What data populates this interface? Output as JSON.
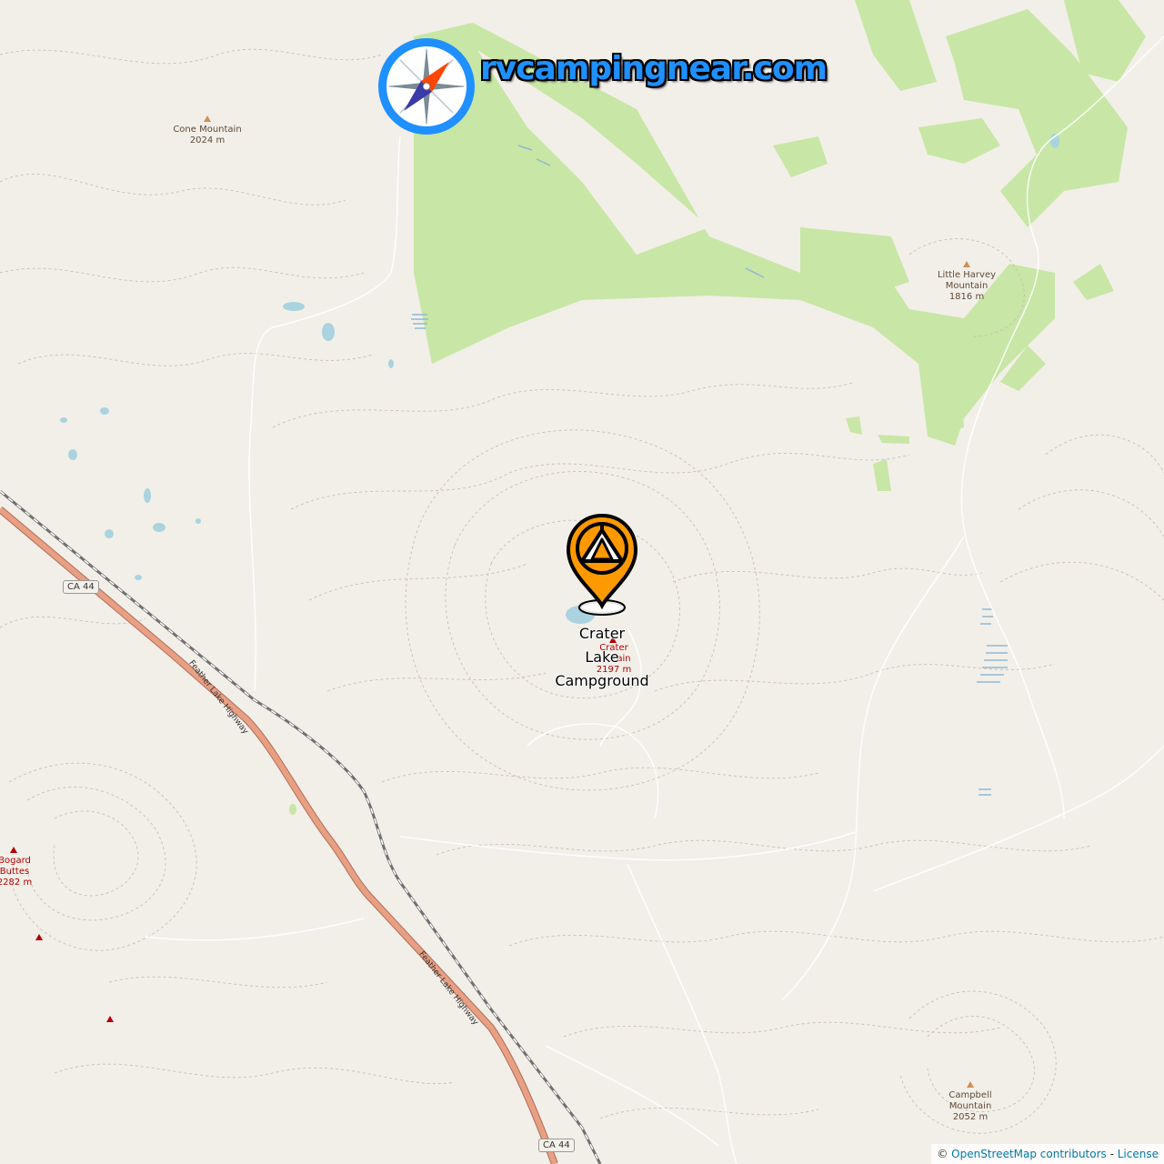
{
  "brand": {
    "site_name": "rvcampingnear.com",
    "icon": "compass-icon",
    "colors": {
      "ring": "#1e90ff",
      "needle_north": "#ff4500",
      "needle_south": "#3a3aa8"
    }
  },
  "campground": {
    "name": "Crater Lake Campground",
    "name_lines": [
      "Crater",
      "Lake",
      "Campground"
    ],
    "icon": "tent-map-pin-icon",
    "pin_color": "#ff9900"
  },
  "peaks": [
    {
      "name": "Cone Mountain",
      "elevation": "2024 m"
    },
    {
      "name_lines": [
        "Little Harvey",
        "Mountain"
      ],
      "elevation": "1816 m"
    },
    {
      "name_lines": [
        "Crater",
        "Mountain"
      ],
      "visible_text": [
        "Crater",
        "ain"
      ],
      "elevation": "2197 m"
    },
    {
      "name_lines": [
        "Bogard",
        "Buttes"
      ],
      "elevation": "2282 m"
    },
    {
      "name_lines": [
        "Campbell",
        "Mountain"
      ],
      "elevation": "2052 m"
    }
  ],
  "roads": {
    "shield_top": "CA 44",
    "shield_bottom": "CA 44",
    "highway_name_1": "Feather Lake Highway",
    "highway_name_2": "Feather Lake Highway"
  },
  "attribution": {
    "copyright": "©",
    "osm_link": "OpenStreetMap contributors",
    "separator": " - ",
    "license_link": "License"
  },
  "colors": {
    "land": "#f2efe9",
    "forest": "#c8e6a5",
    "water": "#aad3df",
    "highway": "#e8a083",
    "railway": "#707070",
    "contour": "#c9bfae"
  }
}
